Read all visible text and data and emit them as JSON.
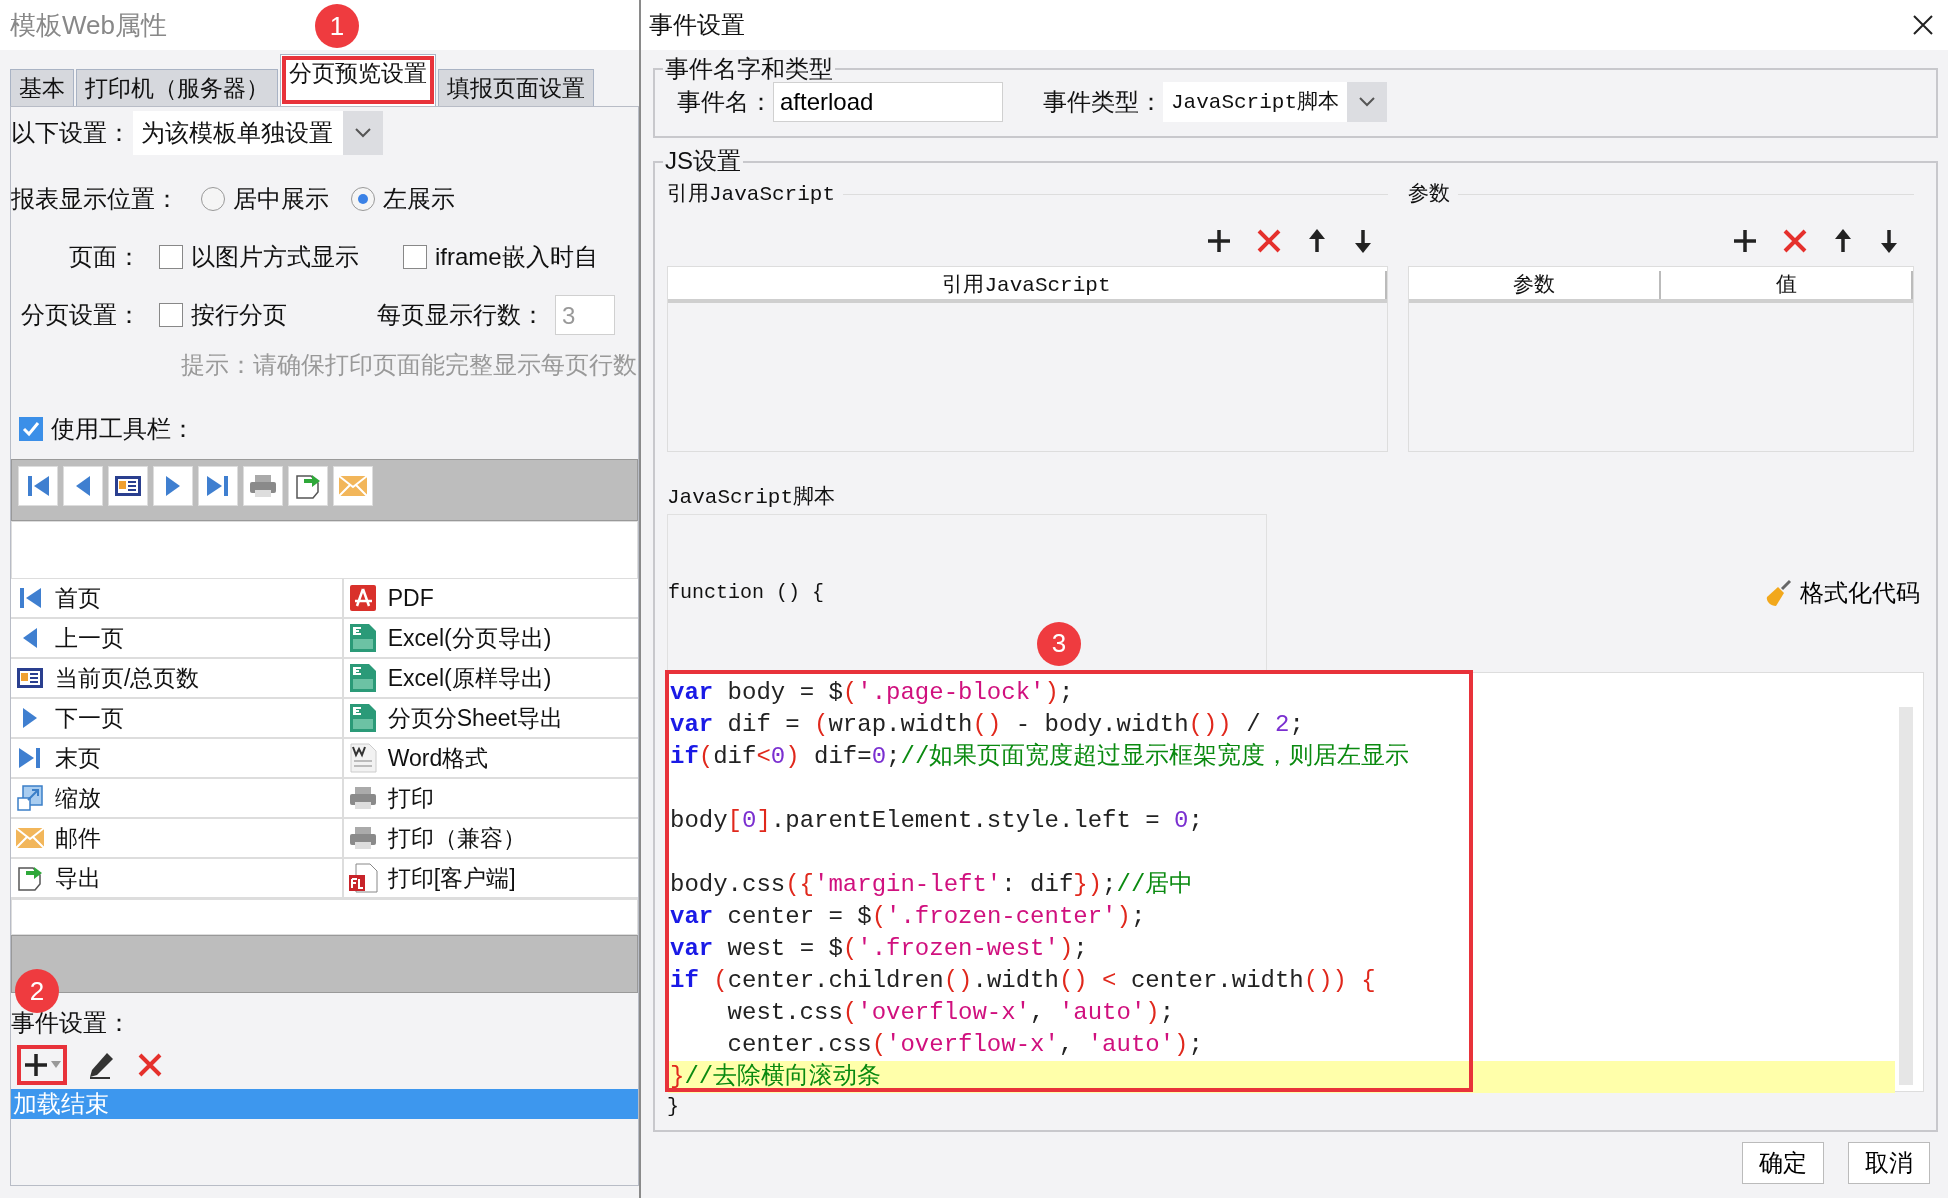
{
  "left_panel": {
    "title": "模板Web属性",
    "tabs": [
      {
        "label": "基本",
        "selected": false,
        "outlined": false
      },
      {
        "label": "打印机（服务器）",
        "selected": false,
        "outlined": false
      },
      {
        "label": "分页预览设置",
        "selected": true,
        "outlined": true
      },
      {
        "label": "填报页面设置",
        "selected": false,
        "outlined": false
      }
    ],
    "settings_scope": {
      "label": "以下设置：",
      "value": "为该模板单独设置"
    },
    "position": {
      "label": "报表显示位置：",
      "options": [
        {
          "label": "居中展示",
          "selected": false
        },
        {
          "label": "左展示",
          "selected": true
        }
      ]
    },
    "page": {
      "label": "页面：",
      "options": [
        {
          "label": "以图片方式显示",
          "checked": false
        },
        {
          "label": "iframe嵌入时自",
          "checked": false
        }
      ]
    },
    "paging": {
      "label": "分页设置：",
      "option": {
        "label": "按行分页",
        "checked": false
      },
      "rows_label": "每页显示行数：",
      "rows_value": "3"
    },
    "hint": "提示：请确保打印页面能完整显示每页行数",
    "use_toolbar": {
      "label": "使用工具栏：",
      "checked": true
    },
    "button_rows": [
      [
        "首页",
        "PDF"
      ],
      [
        "上一页",
        "Excel(分页导出)"
      ],
      [
        "当前页/总页数",
        "Excel(原样导出)"
      ],
      [
        "下一页",
        "分页分Sheet导出"
      ],
      [
        "末页",
        "Word格式"
      ],
      [
        "缩放",
        "打印"
      ],
      [
        "邮件",
        "打印（兼容）"
      ],
      [
        "导出",
        "打印[客户端]"
      ]
    ],
    "events": {
      "label": "事件设置：",
      "add_outlined": true,
      "items": [
        {
          "label": "加载结束",
          "selected": true
        }
      ]
    }
  },
  "dialog": {
    "title": "事件设置",
    "name_group": {
      "legend": "事件名字和类型",
      "name_label": "事件名：",
      "name_value": "afterload",
      "type_label": "事件类型：",
      "type_value": "JavaScript脚本"
    },
    "js_group": {
      "legend": "JS设置",
      "ref_section": {
        "title": "引用JavaScript",
        "columns": [
          "引用JavaScript"
        ]
      },
      "param_section": {
        "title": "参数",
        "columns": [
          "参数",
          "值"
        ]
      },
      "script_label": "JavaScript脚本",
      "script_header": "function () {",
      "format_button": "格式化代码",
      "code_outlined": true,
      "code_lines": [
        {
          "highlighted": false,
          "tokens": [
            {
              "kind": "kw",
              "text": "var"
            },
            {
              "kind": "pl",
              "text": " body = $"
            },
            {
              "kind": "pn",
              "text": "("
            },
            {
              "kind": "st",
              "text": "'.page-block'"
            },
            {
              "kind": "pn",
              "text": ")"
            },
            {
              "kind": "pl",
              "text": ";"
            }
          ]
        },
        {
          "highlighted": false,
          "tokens": [
            {
              "kind": "kw",
              "text": "var"
            },
            {
              "kind": "pl",
              "text": " dif = "
            },
            {
              "kind": "pn",
              "text": "("
            },
            {
              "kind": "pl",
              "text": "wrap.width"
            },
            {
              "kind": "pn",
              "text": "()"
            },
            {
              "kind": "pl",
              "text": " - body.width"
            },
            {
              "kind": "pn",
              "text": "())"
            },
            {
              "kind": "pl",
              "text": " / "
            },
            {
              "kind": "nm",
              "text": "2"
            },
            {
              "kind": "pl",
              "text": ";"
            }
          ]
        },
        {
          "highlighted": false,
          "tokens": [
            {
              "kind": "kw",
              "text": "if"
            },
            {
              "kind": "pn",
              "text": "("
            },
            {
              "kind": "pl",
              "text": "dif"
            },
            {
              "kind": "pn",
              "text": "<"
            },
            {
              "kind": "nm",
              "text": "0"
            },
            {
              "kind": "pn",
              "text": ")"
            },
            {
              "kind": "pl",
              "text": " dif="
            },
            {
              "kind": "nm",
              "text": "0"
            },
            {
              "kind": "pl",
              "text": ";"
            },
            {
              "kind": "cm",
              "text": "//如果页面宽度超过显示框架宽度，则居左显示"
            }
          ]
        },
        {
          "highlighted": false
        },
        {
          "highlighted": false,
          "tokens": [
            {
              "kind": "pl",
              "text": "body"
            },
            {
              "kind": "pn",
              "text": "["
            },
            {
              "kind": "nm",
              "text": "0"
            },
            {
              "kind": "pn",
              "text": "]"
            },
            {
              "kind": "pl",
              "text": ".parentElement.style.left = "
            },
            {
              "kind": "nm",
              "text": "0"
            },
            {
              "kind": "pl",
              "text": ";"
            }
          ]
        },
        {
          "highlighted": false
        },
        {
          "highlighted": false,
          "tokens": [
            {
              "kind": "pl",
              "text": "body.css"
            },
            {
              "kind": "pn",
              "text": "({"
            },
            {
              "kind": "st",
              "text": "'margin-left'"
            },
            {
              "kind": "pl",
              "text": ": dif"
            },
            {
              "kind": "pn",
              "text": "})"
            },
            {
              "kind": "pl",
              "text": ";"
            },
            {
              "kind": "cm",
              "text": "//居中"
            }
          ]
        },
        {
          "highlighted": false,
          "tokens": [
            {
              "kind": "kw",
              "text": "var"
            },
            {
              "kind": "pl",
              "text": " center = $"
            },
            {
              "kind": "pn",
              "text": "("
            },
            {
              "kind": "st",
              "text": "'.frozen-center'"
            },
            {
              "kind": "pn",
              "text": ")"
            },
            {
              "kind": "pl",
              "text": ";"
            }
          ]
        },
        {
          "highlighted": false,
          "tokens": [
            {
              "kind": "kw",
              "text": "var"
            },
            {
              "kind": "pl",
              "text": " west = $"
            },
            {
              "kind": "pn",
              "text": "("
            },
            {
              "kind": "st",
              "text": "'.frozen-west'"
            },
            {
              "kind": "pn",
              "text": ")"
            },
            {
              "kind": "pl",
              "text": ";"
            }
          ]
        },
        {
          "highlighted": false,
          "tokens": [
            {
              "kind": "kw",
              "text": "if"
            },
            {
              "kind": "pn",
              "text": " ("
            },
            {
              "kind": "pl",
              "text": "center.children"
            },
            {
              "kind": "pn",
              "text": "()"
            },
            {
              "kind": "pl",
              "text": ".width"
            },
            {
              "kind": "pn",
              "text": "() < "
            },
            {
              "kind": "pl",
              "text": "center.width"
            },
            {
              "kind": "pn",
              "text": "()) {"
            }
          ]
        },
        {
          "highlighted": false,
          "tokens": [
            {
              "kind": "pl",
              "text": "    west.css"
            },
            {
              "kind": "pn",
              "text": "("
            },
            {
              "kind": "st",
              "text": "'overflow-x'"
            },
            {
              "kind": "pl",
              "text": ", "
            },
            {
              "kind": "st",
              "text": "'auto'"
            },
            {
              "kind": "pn",
              "text": ")"
            },
            {
              "kind": "pl",
              "text": ";"
            }
          ]
        },
        {
          "highlighted": false,
          "tokens": [
            {
              "kind": "pl",
              "text": "    center.css"
            },
            {
              "kind": "pn",
              "text": "("
            },
            {
              "kind": "st",
              "text": "'overflow-x'"
            },
            {
              "kind": "pl",
              "text": ", "
            },
            {
              "kind": "st",
              "text": "'auto'"
            },
            {
              "kind": "pn",
              "text": ")"
            },
            {
              "kind": "pl",
              "text": ";"
            }
          ]
        },
        {
          "highlighted": true,
          "tokens": [
            {
              "kind": "pn",
              "text": "}"
            },
            {
              "kind": "cm",
              "text": "//去除横向滚动条"
            }
          ]
        }
      ],
      "script_footer": "}"
    },
    "buttons": [
      "确定",
      "取消"
    ]
  },
  "callouts": [
    "1",
    "2",
    "3"
  ]
}
